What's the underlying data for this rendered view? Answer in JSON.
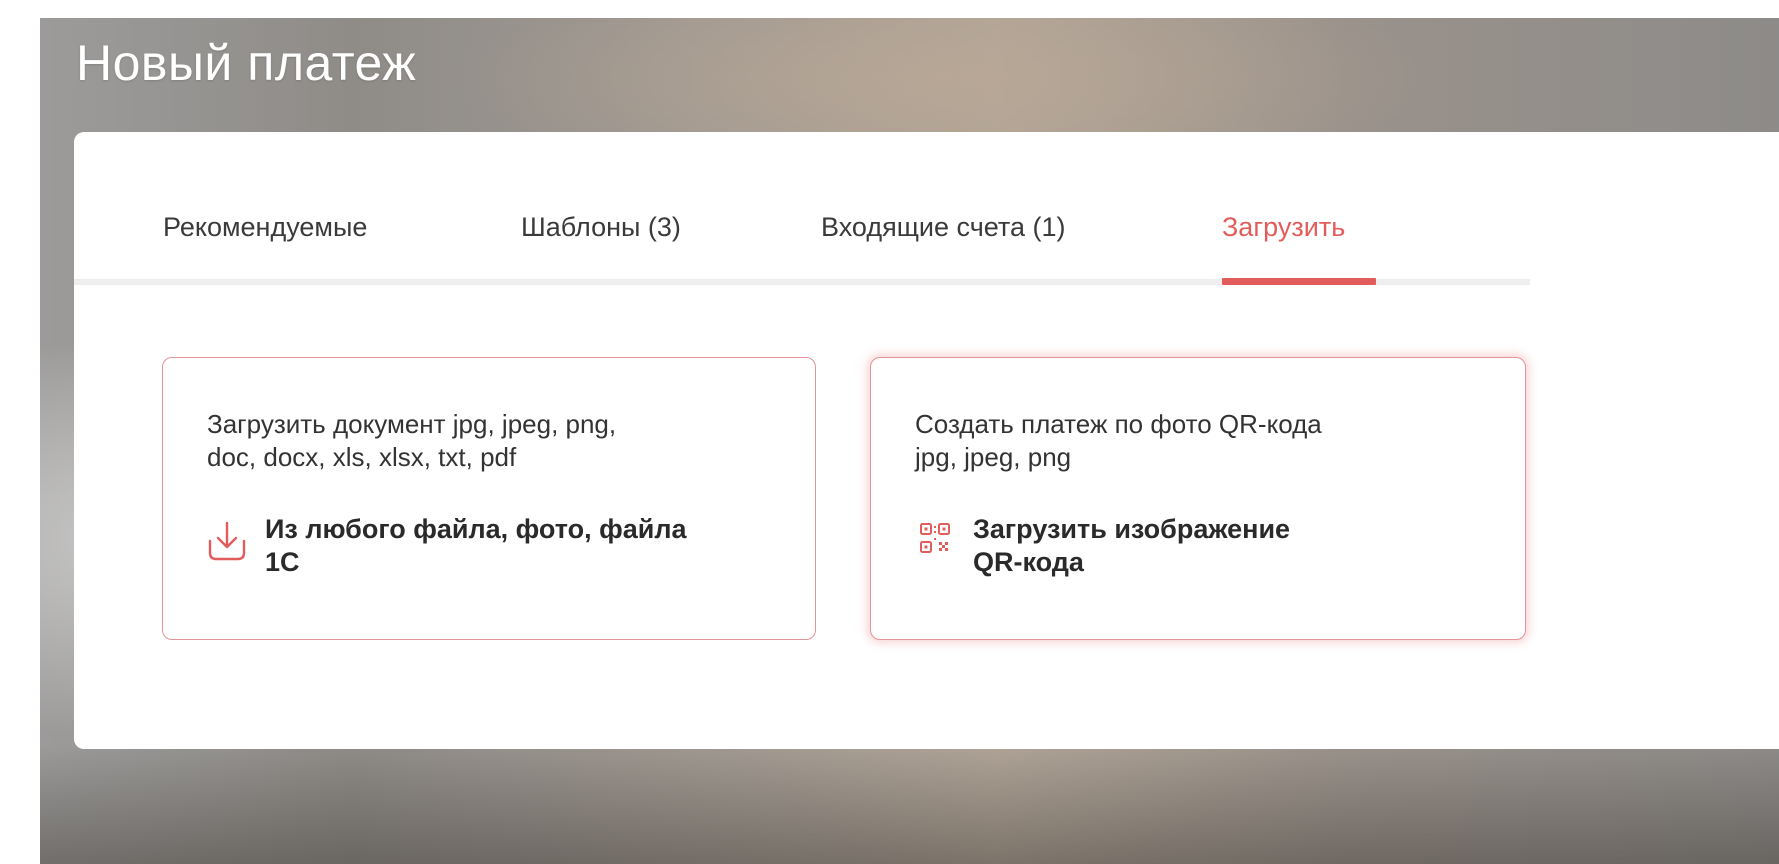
{
  "page": {
    "title": "Новый платеж"
  },
  "tabs": [
    {
      "label": "Рекомендуемые",
      "active": false
    },
    {
      "label": "Шаблоны (3)",
      "active": false
    },
    {
      "label": "Входящие счета (1)",
      "active": false
    },
    {
      "label": "Загрузить",
      "active": true
    }
  ],
  "upload": {
    "file": {
      "description_lines": [
        "Загрузить документ jpg, jpeg, png,",
        "doc, docx, xls, xlsx, txt, pdf"
      ],
      "action_lines": [
        "Из любого файла, фото, файла",
        "1С"
      ],
      "icon": "download-tray-icon"
    },
    "qr": {
      "description_lines": [
        "Создать платеж по фото QR-кода",
        "jpg, jpeg, png"
      ],
      "action_lines": [
        "Загрузить изображение",
        "QR-кода"
      ],
      "icon": "qr-code-icon"
    }
  },
  "colors": {
    "accent": "#e25c5c",
    "card_border": "#e5949a",
    "text": "#333333"
  }
}
